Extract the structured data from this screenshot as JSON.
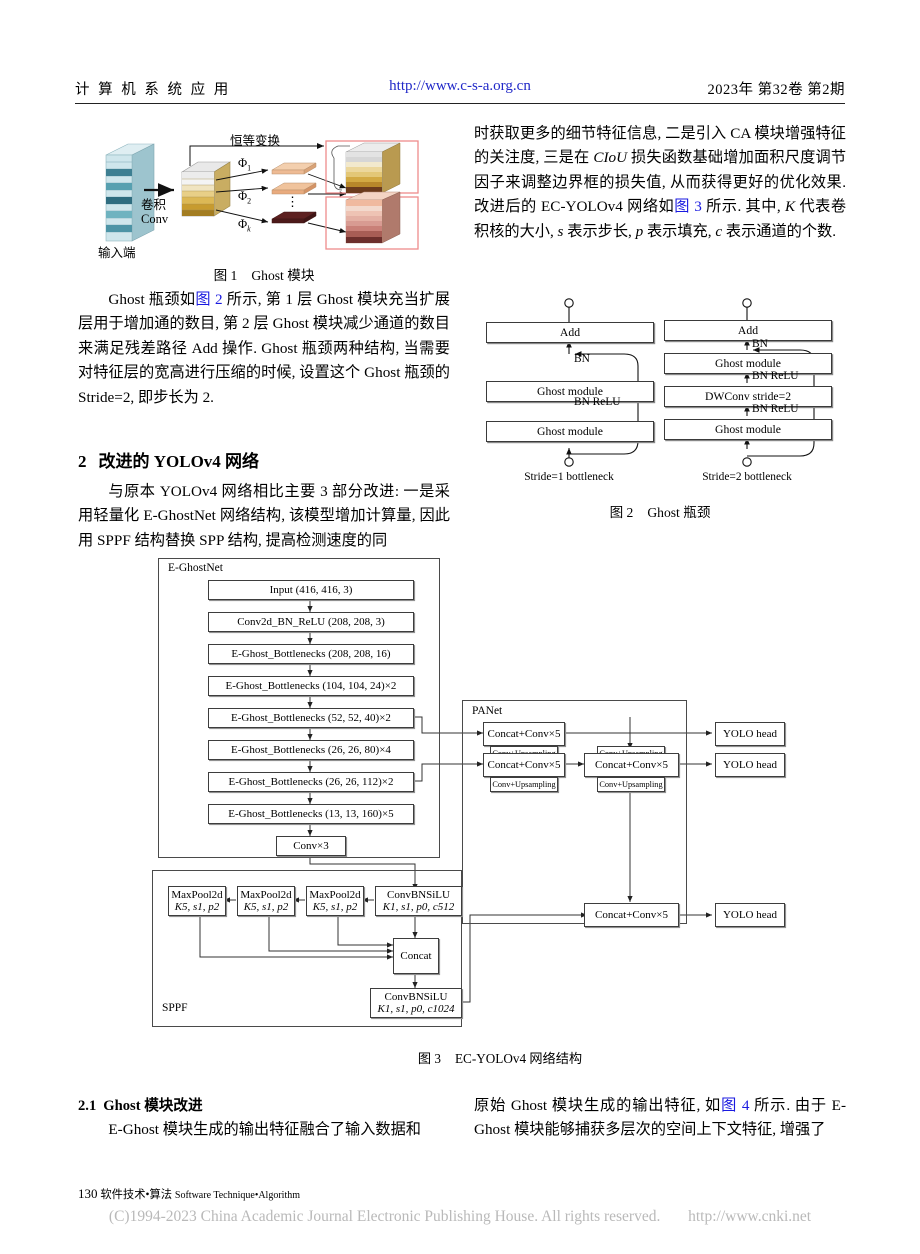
{
  "header": {
    "journal_cn": "计 算 机 系 统 应 用",
    "url": "http://www.c-s-a.org.cn",
    "issue": "2023年 第32卷 第2期",
    "link_color": "#2028c8"
  },
  "figure1": {
    "caption_num": "图 1",
    "caption_text": "Ghost 模块",
    "labels": {
      "input": "输入端",
      "conv_cn": "卷积",
      "conv_en": "Conv",
      "identity": "恒等变换",
      "phi1": "Φ",
      "phi1_sub": "1",
      "phi2": "Φ",
      "phi2_sub": "2",
      "phik": "Φ",
      "phik_sub": "k",
      "dots": "⋮"
    }
  },
  "figure2": {
    "caption_num": "图 2",
    "caption_text": "Ghost 瓶颈",
    "left": {
      "title": "Stride=1 bottleneck",
      "nodes": [
        "Add",
        "Ghost module",
        "Ghost module"
      ],
      "edge_labels": [
        "BN",
        "BN ReLU"
      ]
    },
    "right": {
      "title": "Stride=2 bottleneck",
      "nodes": [
        "Add",
        "Ghost module",
        "DWConv stride=2",
        "Ghost module"
      ],
      "edge_labels": [
        "BN",
        "BN ReLU",
        "BN ReLU"
      ]
    }
  },
  "figure3": {
    "caption_num": "图 3",
    "caption_text": "EC-YOLOv4 网络结构",
    "groups": {
      "backbone": "E-GhostNet",
      "neck": "PANet",
      "sppf": "SPPF"
    },
    "backbone_nodes": [
      "Input (416, 416, 3)",
      "Conv2d_BN_ReLU (208, 208, 3)",
      "E-Ghost_Bottlenecks (208, 208, 16)",
      "E-Ghost_Bottlenecks (104, 104, 24)×2",
      "E-Ghost_Bottlenecks (52, 52, 40)×2",
      "E-Ghost_Bottlenecks (26, 26, 80)×4",
      "E-Ghost_Bottlenecks (26, 26, 112)×2",
      "E-Ghost_Bottlenecks (13, 13, 160)×5",
      "Conv×3"
    ],
    "panet_nodes": {
      "concat1": "Concat+Conv×5",
      "concat2": "Concat+Conv×5",
      "concat3": "Concat+Conv×5",
      "concat4": "Concat+Conv×5",
      "ups_a": "Conv+Upsampling",
      "ups_b": "Conv+Upsampling",
      "ups_c": "Conv+Upsampling",
      "ups_d": "Conv+Upsampling"
    },
    "yolo_heads": [
      "YOLO head",
      "YOLO head",
      "YOLO head"
    ],
    "sppf_nodes": {
      "maxpool_title": "MaxPool2d",
      "maxpool_params": "K5, s1, p2",
      "conv512_title": "ConvBNSiLU",
      "conv512_params": "K1, s1, p0, c512",
      "concat": "Concat",
      "conv1024_title": "ConvBNSiLU",
      "conv1024_params": "K1, s1, p0, c1024"
    }
  },
  "body": {
    "left": {
      "p1_a": "Ghost 瓶颈如",
      "p1_link": "图 2",
      "p1_b": " 所示, 第 1 层 Ghost 模块充当扩展层用于增加通的数目, 第 2 层 Ghost 模块减少通道的数目来满足残差路径 Add 操作. Ghost 瓶颈两种结构, 当需要对特征层的宽高进行压缩的时候, 设置这个 Ghost 瓶颈的 Stride=2, 即步长为 2.",
      "h2_num": "2",
      "h2_title": "改进的 YOLOv4 网络",
      "p2": "与原本 YOLOv4 网络相比主要 3 部分改进: 一是采用轻量化 E-GhostNet 网络结构, 该模型增加计算量, 因此用 SPPF 结构替换 SPP 结构, 提高检测速度的同"
    },
    "right": {
      "p1_a": "时获取更多的细节特征信息, 二是引入 CA 模块增强特征的关注度, 三是在 ",
      "p1_ital": "CIoU",
      "p1_b": " 损失函数基础增加面积尺度调节因子来调整边界框的损失值, 从而获得更好的优化效果. 改进后的 EC-YOLOv4 网络如",
      "p1_link": "图 3",
      "p1_c": " 所示. 其中, ",
      "p1_k": "K",
      "p1_d": " 代表卷积核的大小, ",
      "p1_s": "s",
      "p1_e": " 表示步长, ",
      "p1_p": "p",
      "p1_f": " 表示填充, ",
      "p1_c2": "c",
      "p1_g": " 表示通道的个数."
    },
    "sec21": {
      "num": "2.1",
      "title": "Ghost 模块改进",
      "left_p": "E-Ghost 模块生成的输出特征融合了输入数据和",
      "right_a": "原始 Ghost 模块生成的输出特征, 如",
      "right_link": "图 4",
      "right_b": " 所示. 由于 E-Ghost 模块能够捕获多层次的空间上下文特征, 增强了"
    }
  },
  "footer": {
    "page_num": "130",
    "section_cn": "软件技术•算法",
    "section_en": "Software Technique•Algorithm",
    "copyright": "(C)1994-2023 China Academic Journal Electronic Publishing House. All rights reserved.",
    "cnki_url": "http://www.cnki.net"
  }
}
